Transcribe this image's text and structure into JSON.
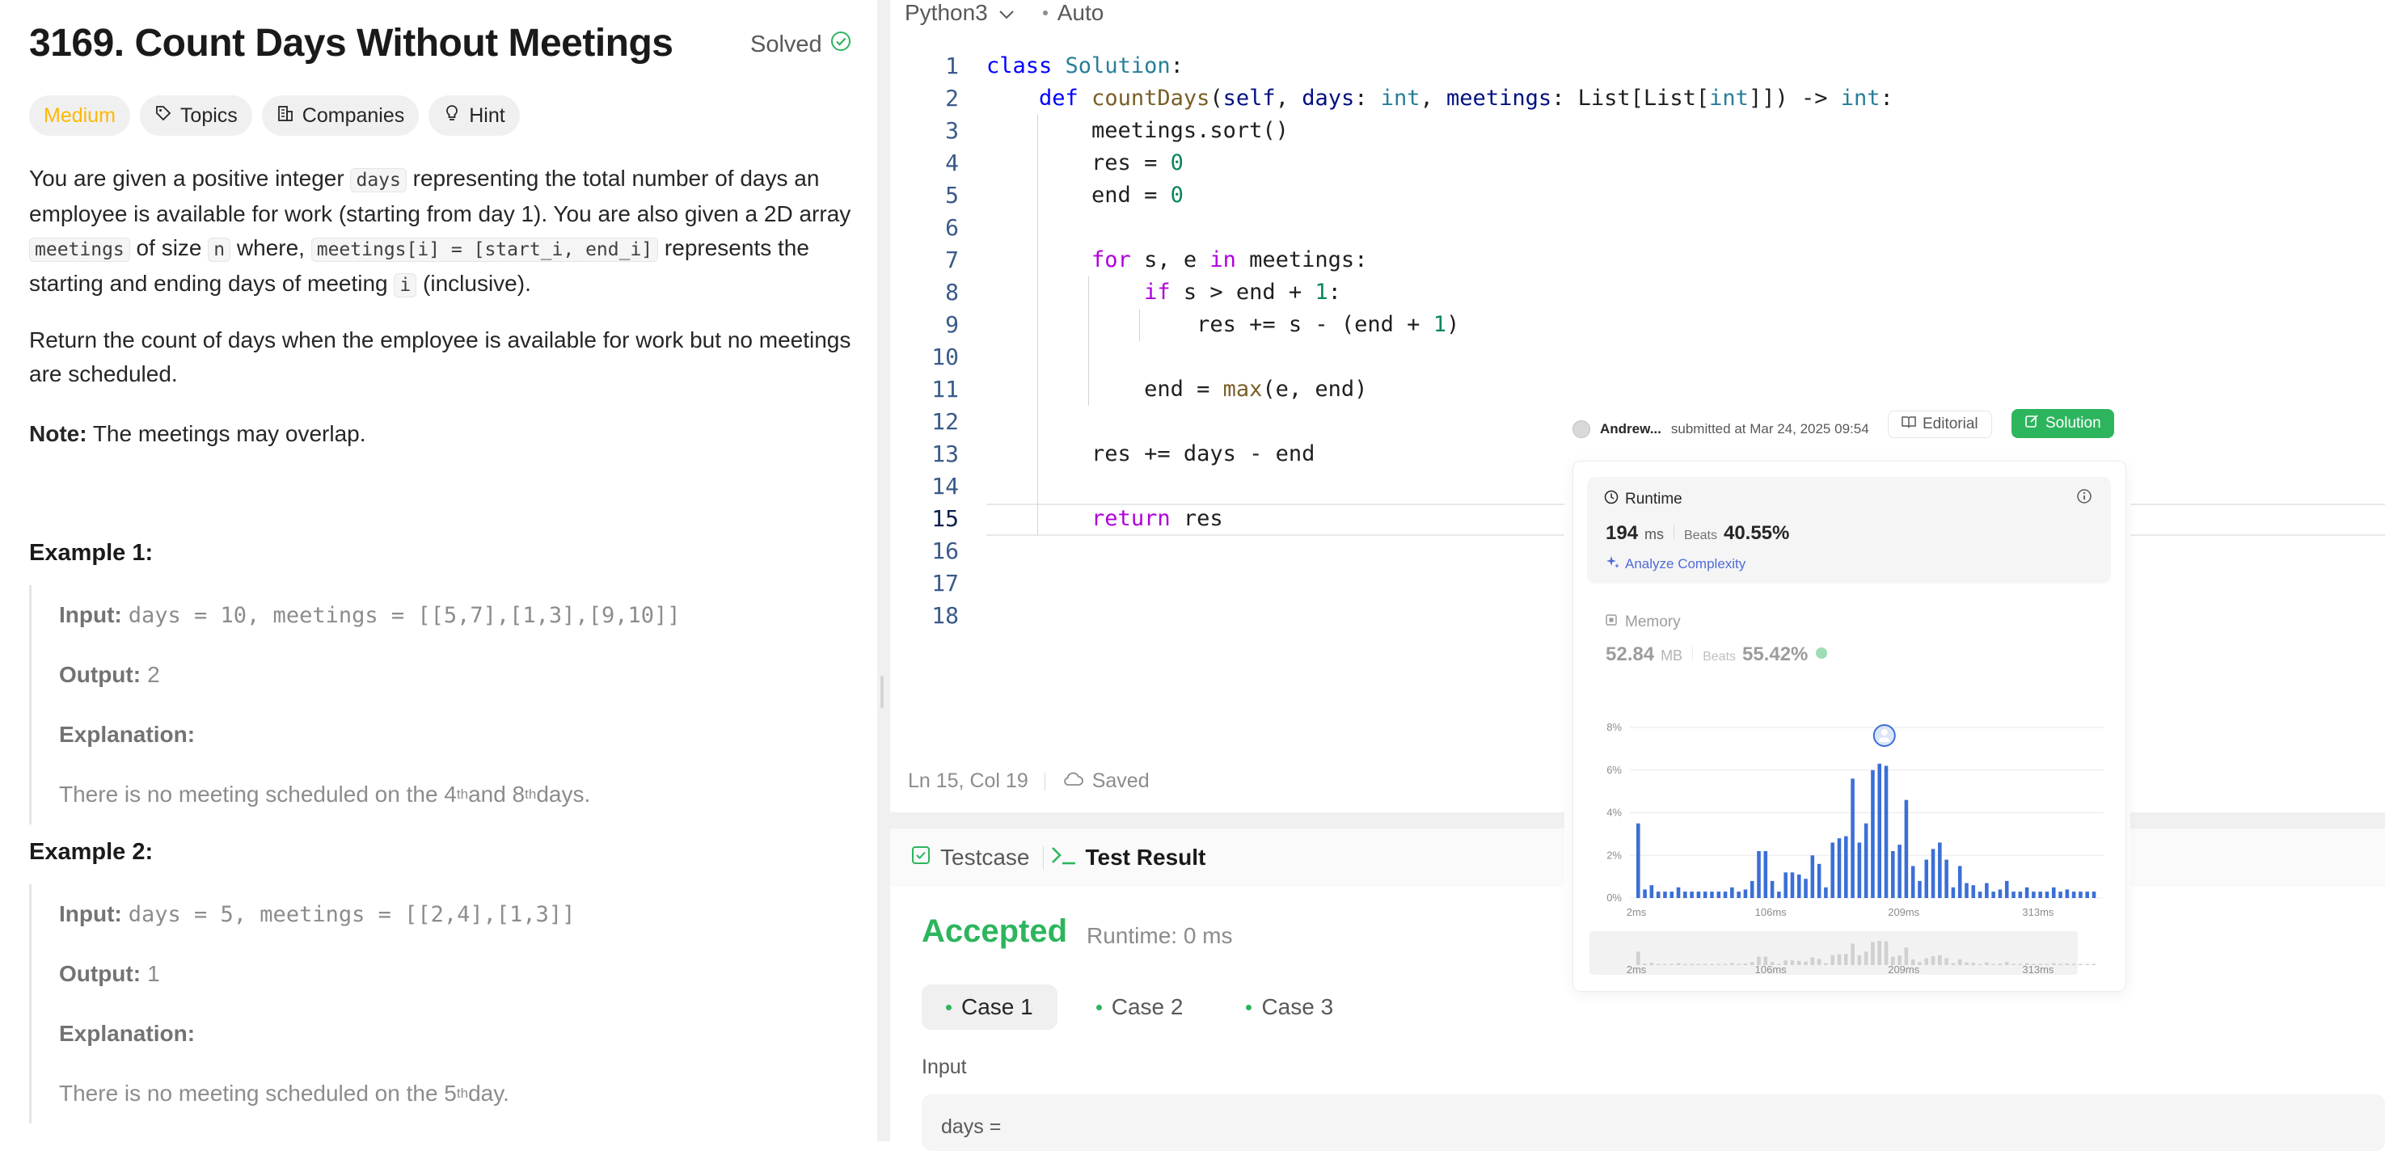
{
  "problem": {
    "title": "3169. Count Days Without Meetings",
    "status": "Solved",
    "tags": [
      "Medium",
      "Topics",
      "Companies",
      "Hint"
    ],
    "desc_p1": [
      "You are given a positive integer ",
      "days",
      " representing the total number of days an employee is available for work (starting from day 1). You are also given a 2D array ",
      "meetings",
      " of size ",
      "n",
      " where, ",
      "meetings[i] = [start_i, end_i]",
      " represents the starting and ending days of meeting ",
      "i",
      " (inclusive)."
    ],
    "desc_p2": "Return the count of days when the employee is available for work but no meetings are scheduled.",
    "note_label": "Note:",
    "note_text": " The meetings may overlap.",
    "examples": [
      {
        "heading": "Example 1:",
        "input_label": "Input:",
        "input": "days = 10, meetings = [[5,7],[1,3],[9,10]]",
        "output_label": "Output:",
        "output": "2",
        "explanation_label": "Explanation:",
        "explanation": [
          "There is no meeting scheduled on the 4",
          "th",
          " and 8",
          "th",
          " days."
        ]
      },
      {
        "heading": "Example 2:",
        "input_label": "Input:",
        "input": "days = 5, meetings = [[2,4],[1,3]]",
        "output_label": "Output:",
        "output": "1",
        "explanation_label": "Explanation:",
        "explanation": [
          "There is no meeting scheduled on the 5",
          "th",
          " day."
        ]
      }
    ]
  },
  "editor": {
    "language": "Python3",
    "mode": "Auto",
    "line_numbers": [
      "1",
      "2",
      "3",
      "4",
      "5",
      "6",
      "7",
      "8",
      "9",
      "10",
      "11",
      "12",
      "13",
      "14",
      "15",
      "16",
      "17",
      "18"
    ],
    "current_line": 15,
    "status_position": "Ln 15, Col 19",
    "status_saved": "Saved"
  },
  "result": {
    "tabs": [
      "Testcase",
      "Test Result"
    ],
    "verdict": "Accepted",
    "runtime": "Runtime: 0 ms",
    "cases": [
      "Case 1",
      "Case 2",
      "Case 3"
    ],
    "input_label": "Input",
    "input_value": "days ="
  },
  "submission": {
    "user": "Andrew...",
    "submitted": "submitted at Mar 24, 2025 09:54",
    "editorial_label": "Editorial",
    "solution_label": "Solution",
    "runtime_label": "Runtime",
    "runtime_value": "194",
    "runtime_unit": "ms",
    "beats_label": "Beats",
    "runtime_beats": "40.55%",
    "analyze_label": "Analyze Complexity",
    "memory_label": "Memory",
    "memory_value": "52.84",
    "memory_unit": "MB",
    "memory_beats": "55.42%"
  },
  "colors": {
    "accepted": "#2db55d",
    "medium": "#ffb800",
    "bar": "#3b6fd6",
    "link": "#4f6bd9"
  },
  "chart_data": {
    "type": "bar",
    "title": "",
    "xlabel": "",
    "ylabel": "",
    "ylim": [
      0,
      8
    ],
    "yticks": [
      "0%",
      "2%",
      "4%",
      "6%",
      "8%"
    ],
    "xticks": [
      "2ms",
      "106ms",
      "209ms",
      "313ms"
    ],
    "xrange_ms": [
      2,
      360
    ],
    "highlight_ms": 194,
    "values": [
      3.5,
      0.4,
      0.6,
      0.3,
      0.3,
      0.3,
      0.5,
      0.3,
      0.3,
      0.3,
      0.3,
      0.3,
      0.3,
      0.3,
      0.5,
      0.3,
      0.4,
      0.8,
      2.2,
      2.2,
      0.8,
      0.3,
      1.2,
      1.2,
      1.1,
      0.9,
      2.0,
      1.6,
      0.5,
      2.6,
      2.8,
      2.9,
      5.6,
      2.6,
      3.5,
      6.0,
      6.3,
      6.2,
      2.2,
      2.5,
      4.6,
      1.5,
      0.8,
      1.8,
      2.3,
      2.6,
      1.8,
      0.5,
      1.5,
      0.7,
      0.6,
      0.3,
      0.7,
      0.3,
      0.4,
      0.8,
      0.3,
      0.3,
      0.5,
      0.3,
      0.3,
      0.3,
      0.5,
      0.3,
      0.4,
      0.3,
      0.3,
      0.3,
      0.3
    ]
  }
}
